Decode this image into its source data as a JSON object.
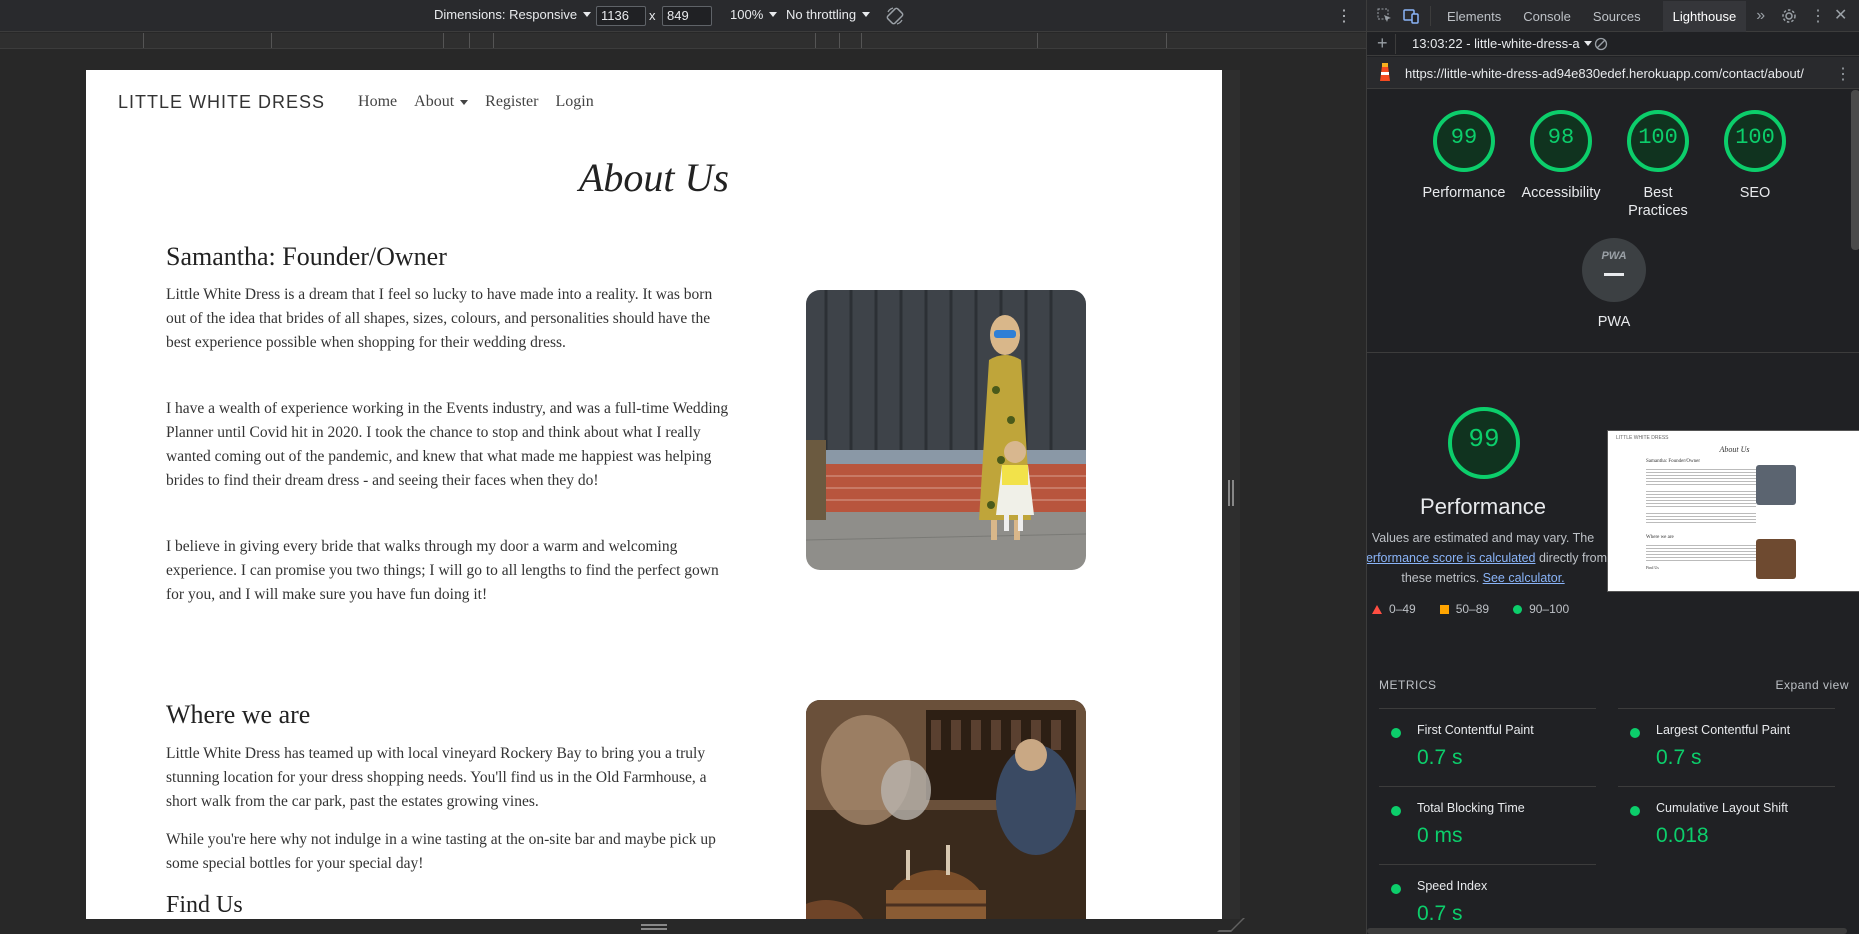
{
  "device_toolbar": {
    "dimensions_label": "Dimensions: Responsive",
    "width": "1136",
    "times": "x",
    "height": "849",
    "zoom": "100%",
    "throttling": "No throttling"
  },
  "site": {
    "brand": "LITTLE WHITE DRESS",
    "nav": [
      {
        "label": "Home"
      },
      {
        "label": "About"
      },
      {
        "label": "Register"
      },
      {
        "label": "Login"
      }
    ],
    "page_title": "About Us",
    "sections": {
      "founder": {
        "heading": "Samantha: Founder/Owner",
        "paragraphs": [
          "Little White Dress is a dream that I feel so lucky to have made into a reality. It was born out of the idea that brides of all shapes, sizes, colours, and personalities should have the best experience possible when shopping for their wedding dress.",
          "I have a wealth of experience working in the Events industry, and was a full-time Wedding Planner until Covid hit in 2020. I took the chance to stop and think about what I really wanted coming out of the pandemic, and knew that what made me happiest was helping brides to find their dream dress - and seeing their faces when they do!",
          "I believe in giving every bride that walks through my door a warm and welcoming experience. I can promise you two things; I will go to all lengths to find the perfect gown for you, and I will make sure you have fun doing it!"
        ]
      },
      "location": {
        "heading": "Where we are",
        "paragraphs": [
          "Little White Dress has teamed up with local vineyard Rockery Bay to bring you a truly stunning location for your dress shopping needs. You'll find us in the Old Farmhouse, a short walk from the car park, past the estates growing vines.",
          "While you're here why not indulge in a wine tasting at the on-site bar and maybe pick up some special bottles for your special day!"
        ]
      },
      "find_us": {
        "heading": "Find Us"
      }
    }
  },
  "devtools": {
    "tabs": [
      "Elements",
      "Console",
      "Sources",
      "Lighthouse"
    ],
    "active_tab": "Lighthouse",
    "more_tabs": "»",
    "report_selector": "13:03:22 - little-white-dress-a",
    "report_url": "https://little-white-dress-ad94e830edef.herokuapp.com/contact/about/",
    "scores": [
      {
        "label": "Performance",
        "value": "99"
      },
      {
        "label": "Accessibility",
        "value": "98"
      },
      {
        "label": "Best Practices",
        "value": "100"
      },
      {
        "label": "SEO",
        "value": "100"
      }
    ],
    "pwa": {
      "label": "PWA",
      "badge": "PWA"
    },
    "performance": {
      "score": "99",
      "title": "Performance",
      "note_1": "Values are estimated and may vary. The",
      "note_link": "performance score is calculated",
      "note_2": " directly from",
      "note_3": "these metrics. ",
      "note_link2": "See calculator."
    },
    "legend": [
      {
        "label": "0–49",
        "color": "#ff4e42"
      },
      {
        "label": "50–89",
        "color": "#ffa400"
      },
      {
        "label": "90–100",
        "color": "#0cce6b"
      }
    ],
    "metrics_header": "METRICS",
    "expand_view": "Expand view",
    "metrics": [
      {
        "name": "First Contentful Paint",
        "value": "0.7 s"
      },
      {
        "name": "Largest Contentful Paint",
        "value": "0.7 s"
      },
      {
        "name": "Total Blocking Time",
        "value": "0 ms"
      },
      {
        "name": "Cumulative Layout Shift",
        "value": "0.018"
      },
      {
        "name": "Speed Index",
        "value": "0.7 s"
      }
    ],
    "thumbnail": {
      "brand": "LITTLE WHITE DRESS",
      "title": "About Us",
      "heading": "Samantha: Founder/Owner",
      "heading2": "Where we are",
      "find_us": "Find Us"
    }
  },
  "colors": {
    "pass": "#0cce6b",
    "accent": "#8ab4f8"
  }
}
